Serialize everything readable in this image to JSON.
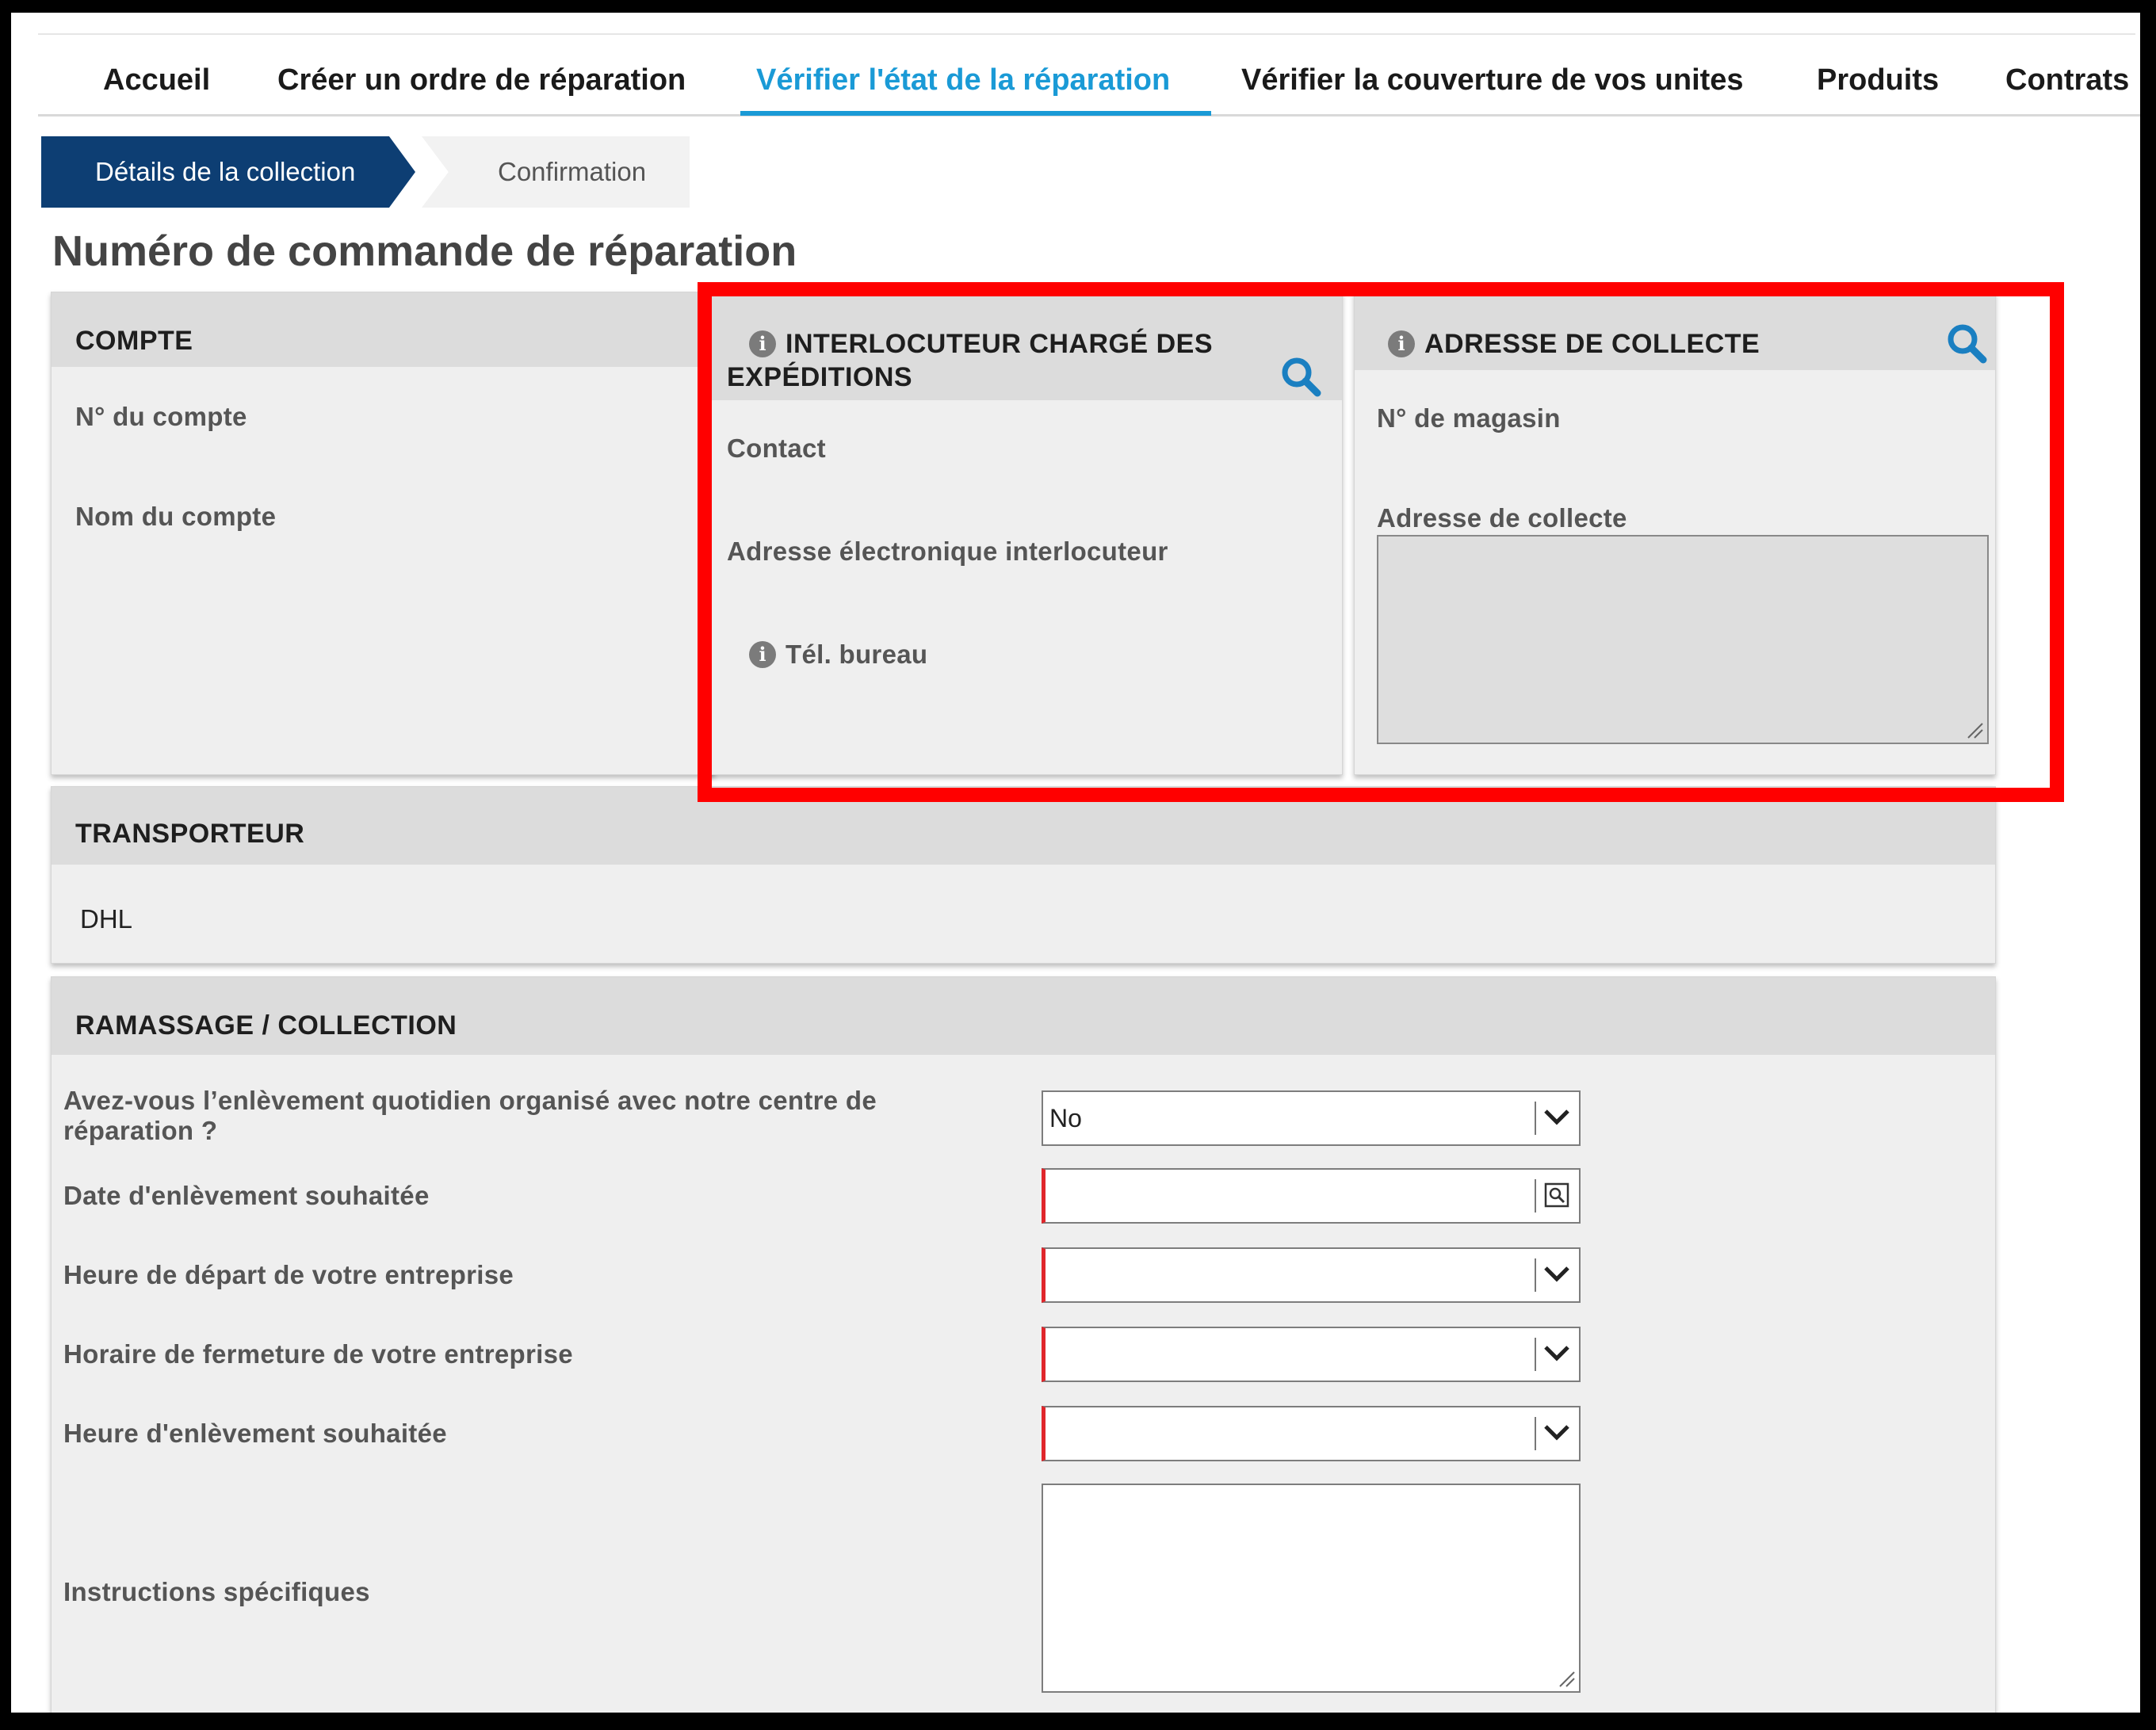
{
  "nav": {
    "items": [
      {
        "label": "Accueil"
      },
      {
        "label": "Créer un ordre de réparation"
      },
      {
        "label": "Vérifier l'état de la réparation"
      },
      {
        "label": "Vérifier la couverture de vos unites"
      },
      {
        "label": "Produits"
      },
      {
        "label": "Contrats"
      }
    ],
    "active_index": 2,
    "active_color": "#1a9ad6"
  },
  "steps": [
    {
      "label": "Détails de la collection",
      "state": "active",
      "color": "#0d3e73"
    },
    {
      "label": "Confirmation",
      "state": "inactive"
    }
  ],
  "page_title": "Numéro de commande de réparation",
  "compte": {
    "title": "COMPTE",
    "fields": [
      {
        "label": "N° du compte"
      },
      {
        "label": "Nom du compte"
      }
    ]
  },
  "interlocuteur": {
    "title_line1": "INTERLOCUTEUR CHARGÉ DES",
    "title_line2": "EXPÉDITIONS",
    "fields": [
      {
        "label": "Contact"
      },
      {
        "label": "Adresse électronique interlocuteur"
      },
      {
        "label": "Tél. bureau"
      }
    ],
    "icons": [
      "info-icon",
      "search-icon"
    ]
  },
  "adresse": {
    "title": "ADRESSE DE COLLECTE",
    "fields": [
      {
        "label": "N° de magasin"
      },
      {
        "label": "Adresse de collecte"
      }
    ],
    "icons": [
      "info-icon",
      "search-icon"
    ]
  },
  "transporteur": {
    "title": "TRANSPORTEUR",
    "value": "DHL"
  },
  "ramassage": {
    "title": "RAMASSAGE / COLLECTION",
    "q1_line1": "Avez-vous l’enlèvement quotidien organisé avec notre centre de",
    "q1_line2": "réparation ?",
    "q1_value": "No",
    "date_label": "Date d'enlèvement souhaitée",
    "depart_label": "Heure de départ de votre entreprise",
    "fermeture_label": "Horaire de fermeture de votre entreprise",
    "heure_label": "Heure d'enlèvement souhaitée",
    "instructions_label": "Instructions spécifiques"
  },
  "colors": {
    "highlight": "#ff0000",
    "required": "#e0262b",
    "icon_blue": "#1a7fc1"
  }
}
